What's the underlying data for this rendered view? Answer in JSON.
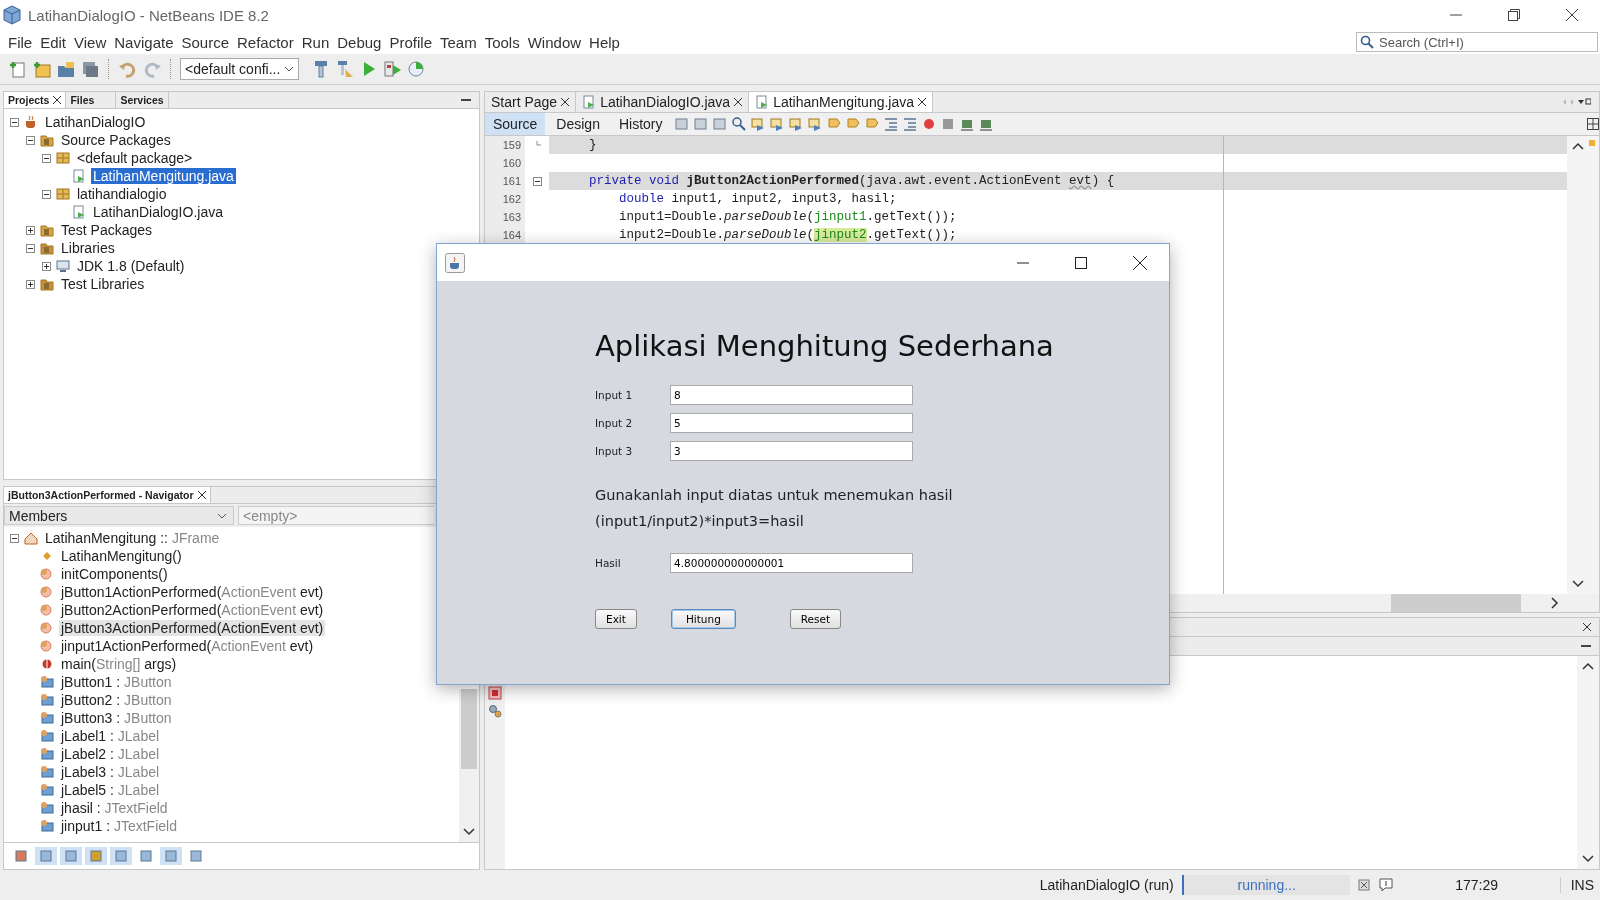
{
  "window": {
    "title": "LatihanDialogIO - NetBeans IDE 8.2"
  },
  "menu": [
    "File",
    "Edit",
    "View",
    "Navigate",
    "Source",
    "Refactor",
    "Run",
    "Debug",
    "Profile",
    "Team",
    "Tools",
    "Window",
    "Help"
  ],
  "search": {
    "placeholder": "Search (Ctrl+I)"
  },
  "toolbar": {
    "config": "<default confi..."
  },
  "project_tabs": [
    {
      "label": "Projects",
      "selected": true
    },
    {
      "label": "Files",
      "selected": false
    },
    {
      "label": "Services",
      "selected": false
    }
  ],
  "project_tree": [
    {
      "label": "LatihanDialogIO",
      "kind": "project",
      "expanded": true,
      "selected": false,
      "children": [
        {
          "label": "Source Packages",
          "kind": "folder",
          "expanded": true,
          "selected": false,
          "children": [
            {
              "label": "<default package>",
              "kind": "package",
              "expanded": true,
              "selected": false,
              "children": [
                {
                  "label": "LatihanMengitung.java",
                  "kind": "file",
                  "selected": true
                }
              ]
            },
            {
              "label": "latihandialogio",
              "kind": "package",
              "expanded": true,
              "selected": false,
              "children": [
                {
                  "label": "LatihanDialogIO.java",
                  "kind": "file",
                  "selected": false
                }
              ]
            }
          ]
        },
        {
          "label": "Test Packages",
          "kind": "folder",
          "expanded": false,
          "selected": false
        },
        {
          "label": "Libraries",
          "kind": "library",
          "expanded": true,
          "selected": false,
          "children": [
            {
              "label": "JDK 1.8 (Default)",
              "kind": "jdk",
              "expanded": false,
              "selected": false
            }
          ]
        },
        {
          "label": "Test Libraries",
          "kind": "library",
          "expanded": false,
          "selected": false
        }
      ]
    }
  ],
  "navigator": {
    "title": "jButton3ActionPerformed - Navigator",
    "filter": "Members",
    "scope": "<empty>",
    "root": {
      "name": "LatihanMengitung :: ",
      "type": "JFrame",
      "expanded": true
    },
    "members": [
      {
        "kind": "constructor",
        "name": "LatihanMengitung()",
        "selected": false
      },
      {
        "kind": "method",
        "name": "initComponents()",
        "selected": false
      },
      {
        "kind": "method",
        "name": "jButton1ActionPerformed(",
        "type": "ActionEvent",
        "rest": " evt)",
        "selected": false
      },
      {
        "kind": "method",
        "name": "jButton2ActionPerformed(",
        "type": "ActionEvent",
        "rest": " evt)",
        "selected": false
      },
      {
        "kind": "method",
        "name": "jButton3ActionPerformed(",
        "type": "ActionEvent",
        "rest": " evt)",
        "selected": true
      },
      {
        "kind": "method",
        "name": "jinput1ActionPerformed(",
        "type": "ActionEvent",
        "rest": " evt)",
        "selected": false
      },
      {
        "kind": "main",
        "name": "main(",
        "type": "String[]",
        "rest": " args)",
        "selected": false
      },
      {
        "kind": "field",
        "name": "jButton1 : ",
        "type": "JButton",
        "selected": false
      },
      {
        "kind": "field",
        "name": "jButton2 : ",
        "type": "JButton",
        "selected": false
      },
      {
        "kind": "field",
        "name": "jButton3 : ",
        "type": "JButton",
        "selected": false
      },
      {
        "kind": "field",
        "name": "jLabel1 : ",
        "type": "JLabel",
        "selected": false
      },
      {
        "kind": "field",
        "name": "jLabel2 : ",
        "type": "JLabel",
        "selected": false
      },
      {
        "kind": "field",
        "name": "jLabel3 : ",
        "type": "JLabel",
        "selected": false
      },
      {
        "kind": "field",
        "name": "jLabel5 : ",
        "type": "JLabel",
        "selected": false
      },
      {
        "kind": "field",
        "name": "jhasil : ",
        "type": "JTextField",
        "selected": false
      },
      {
        "kind": "field",
        "name": "jinput1 : ",
        "type": "JTextField",
        "selected": false
      }
    ]
  },
  "editor_tabs": [
    {
      "label": "Start Page",
      "selected": false
    },
    {
      "label": "LatihanDialogIO.java",
      "selected": false
    },
    {
      "label": "LatihanMengitung.java",
      "selected": true
    }
  ],
  "view_tabs": [
    {
      "label": "Source",
      "selected": true
    },
    {
      "label": "Design",
      "selected": false
    },
    {
      "label": "History",
      "selected": false
    }
  ],
  "code_lines": [
    {
      "number": "159",
      "highlighted": true,
      "fold_start": false,
      "fold_end": true,
      "tokens": [
        {
          "kind": "plain",
          "text": "    }"
        }
      ]
    },
    {
      "number": "160",
      "highlighted": false,
      "fold_start": false,
      "fold_end": false
    },
    {
      "number": "161",
      "highlighted": true,
      "fold_start": true,
      "fold_end": false,
      "tokens": [
        {
          "kind": "keyword",
          "text": "    private"
        },
        {
          "kind": "keyword",
          "text": " void"
        },
        {
          "kind": "bold",
          "text": " jButton2ActionPerformed"
        },
        {
          "kind": "plain",
          "text": "(java.awt.event.ActionEvent "
        },
        {
          "kind": "warning",
          "text": "evt"
        },
        {
          "kind": "plain",
          "text": ") {"
        }
      ]
    },
    {
      "number": "162",
      "highlighted": false,
      "fold_start": false,
      "fold_end": false,
      "tokens": [
        {
          "kind": "keyword",
          "text": "        double"
        },
        {
          "kind": "plain",
          "text": " input1, input2, input3, hasil;"
        }
      ]
    },
    {
      "number": "163",
      "highlighted": false,
      "fold_start": false,
      "fold_end": false,
      "tokens": [
        {
          "kind": "plain",
          "text": "        input1=Double."
        },
        {
          "kind": "italic",
          "text": "parseDouble"
        },
        {
          "kind": "plain",
          "text": "("
        },
        {
          "kind": "field",
          "text": "jinput1"
        },
        {
          "kind": "plain",
          "text": ".getText());"
        }
      ]
    },
    {
      "number": "164",
      "highlighted": false,
      "fold_start": false,
      "fold_end": false,
      "tokens": [
        {
          "kind": "plain",
          "text": "        input2=Double."
        },
        {
          "kind": "italic",
          "text": "parseDouble"
        },
        {
          "kind": "plain",
          "text": "("
        },
        {
          "kind": "field-marked",
          "text": "jinput2"
        },
        {
          "kind": "plain",
          "text": ".getText());"
        }
      ]
    }
  ],
  "dialog": {
    "heading": "Aplikasi Menghitung Sederhana",
    "inputs": [
      {
        "label": "Input 1",
        "value": "8"
      },
      {
        "label": "Input 2",
        "value": "5"
      },
      {
        "label": "Input 3",
        "value": "3"
      }
    ],
    "description": [
      "Gunakanlah input diatas untuk menemukan hasil",
      "(input1/input2)*input3=hasil"
    ],
    "result": {
      "label": "Hasil",
      "value": "4.800000000000001"
    },
    "buttons": [
      {
        "label": "Exit",
        "focused": false
      },
      {
        "label": "Hitung",
        "focused": true
      },
      {
        "label": "Reset",
        "focused": false
      }
    ]
  },
  "status_bar": {
    "task": "LatihanDialogIO (run)",
    "progress": "running...",
    "level": 1,
    "position": "177:29",
    "mode": "INS"
  }
}
